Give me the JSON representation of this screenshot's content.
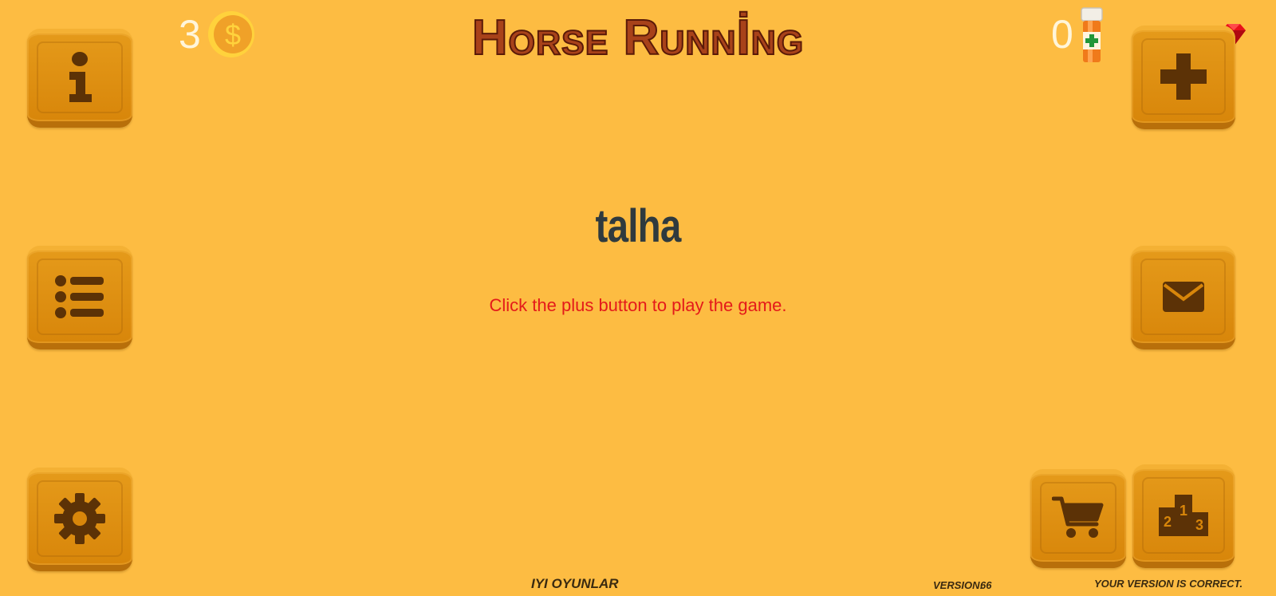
{
  "title": "Horse Runnİng",
  "coins": {
    "count": "3",
    "icon": "dollar-coin-icon"
  },
  "potions": {
    "count": "0",
    "icon": "potion-bottle-icon"
  },
  "gem_icon": "ruby-gem-icon",
  "player_name": "talha",
  "hint": "Click the plus button to play the game.",
  "footer": {
    "brand": "Iyi Oyunlar",
    "version_label": "Version:",
    "version_value": "66",
    "version_status": "Your version is correct."
  },
  "buttons": {
    "info": "info-icon",
    "list": "list-icon",
    "settings": "gear-icon",
    "add": "plus-icon",
    "mail": "mail-icon",
    "shop": "cart-icon",
    "leaderboard": "podium-icon"
  },
  "colors": {
    "background": "#FDBC42",
    "tile": "#DD8F14",
    "icon": "#5C3206",
    "title": "#A8421A",
    "hint": "#E41A1A",
    "player_name": "#2F3A3E"
  }
}
